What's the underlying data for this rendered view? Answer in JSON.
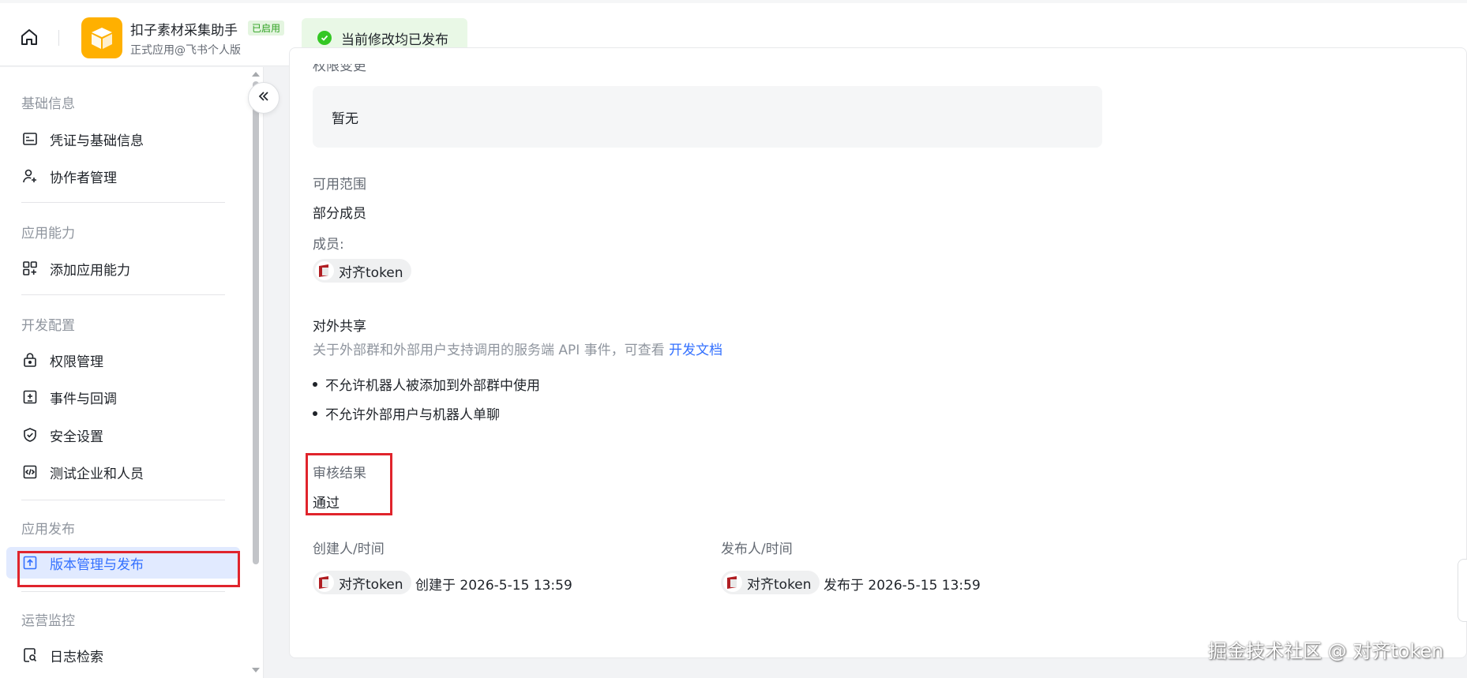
{
  "header": {
    "app_name": "扣子素材采集助手",
    "app_badge": "已启用",
    "app_subtitle": "正式应用@飞书个人版",
    "toast_text": "当前修改均已发布"
  },
  "sidebar": {
    "sections": [
      {
        "title": "基础信息",
        "items": [
          {
            "label": "凭证与基础信息",
            "icon": "credential-icon"
          },
          {
            "label": "协作者管理",
            "icon": "user-add-icon"
          }
        ]
      },
      {
        "title": "应用能力",
        "items": [
          {
            "label": "添加应用能力",
            "icon": "apps-add-icon"
          }
        ]
      },
      {
        "title": "开发配置",
        "items": [
          {
            "label": "权限管理",
            "icon": "lock-icon"
          },
          {
            "label": "事件与回调",
            "icon": "event-icon"
          },
          {
            "label": "安全设置",
            "icon": "shield-icon"
          },
          {
            "label": "测试企业和人员",
            "icon": "code-icon"
          }
        ]
      },
      {
        "title": "应用发布",
        "items": [
          {
            "label": "版本管理与发布",
            "icon": "upload-icon",
            "active": true
          }
        ]
      },
      {
        "title": "运营监控",
        "items": [
          {
            "label": "日志检索",
            "icon": "log-search-icon"
          }
        ]
      }
    ]
  },
  "main": {
    "permission_change_label": "权限变更",
    "permission_change_value": "暂无",
    "scope_label": "可用范围",
    "scope_value": "部分成员",
    "members_label": "成员:",
    "member_name": "对齐token",
    "share_label": "对外共享",
    "share_desc": "关于外部群和外部用户支持调用的服务端 API 事件，可查看",
    "share_link": "开发文档",
    "share_bullets": [
      "不允许机器人被添加到外部群中使用",
      "不允许外部用户与机器人单聊"
    ],
    "review_label": "审核结果",
    "review_value": "通过",
    "creator_label": "创建人/时间",
    "creator_name": "对齐token",
    "created_text": "创建于 2026-5-15 13:59",
    "publisher_label": "发布人/时间",
    "publisher_name": "对齐token",
    "published_text": "发布于 2026-5-15 13:59"
  },
  "watermark": "掘金技术社区 @ 对齐token",
  "colors": {
    "accent": "#3370ff",
    "success": "#34c724",
    "highlight": "#e0242c",
    "app_logo": "#ffb000"
  }
}
